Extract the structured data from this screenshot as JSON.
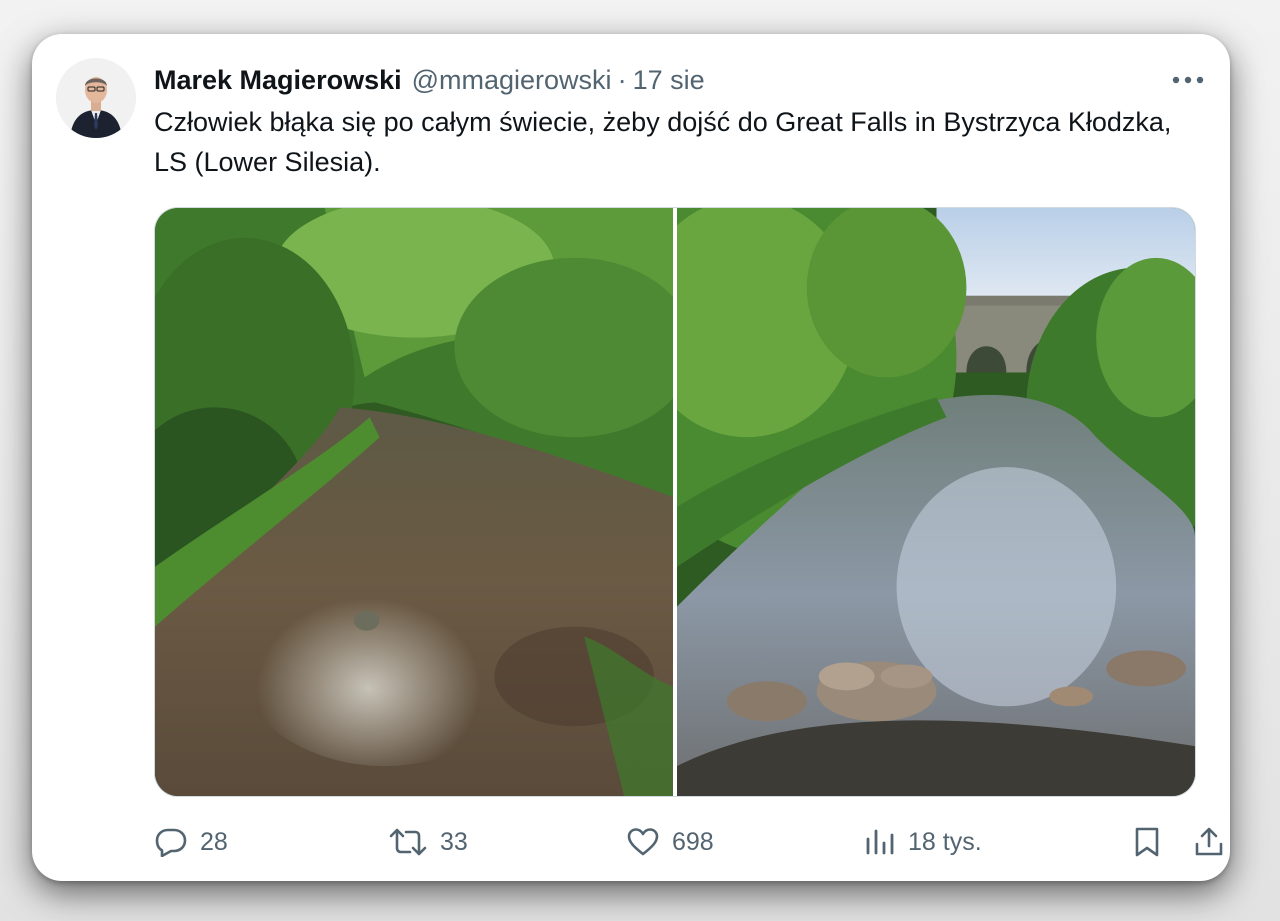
{
  "author": {
    "name": "Marek Magierowski",
    "handle": "@mmagierowski",
    "separator": "·",
    "date": "17 sie"
  },
  "tweet": {
    "text": "Człowiek błąka się po całym świecie, żeby dojść do Great Falls in Bystrzyca Kłodzka, LS (Lower Silesia)."
  },
  "media": [
    {
      "icon": "river-photo-forest"
    },
    {
      "icon": "river-photo-bridge"
    }
  ],
  "actions": {
    "replies": "28",
    "reposts": "33",
    "likes": "698",
    "views": "18 tys."
  },
  "colors": {
    "text_primary": "#0f1419",
    "text_secondary": "#536471",
    "border": "#cfd9de"
  }
}
